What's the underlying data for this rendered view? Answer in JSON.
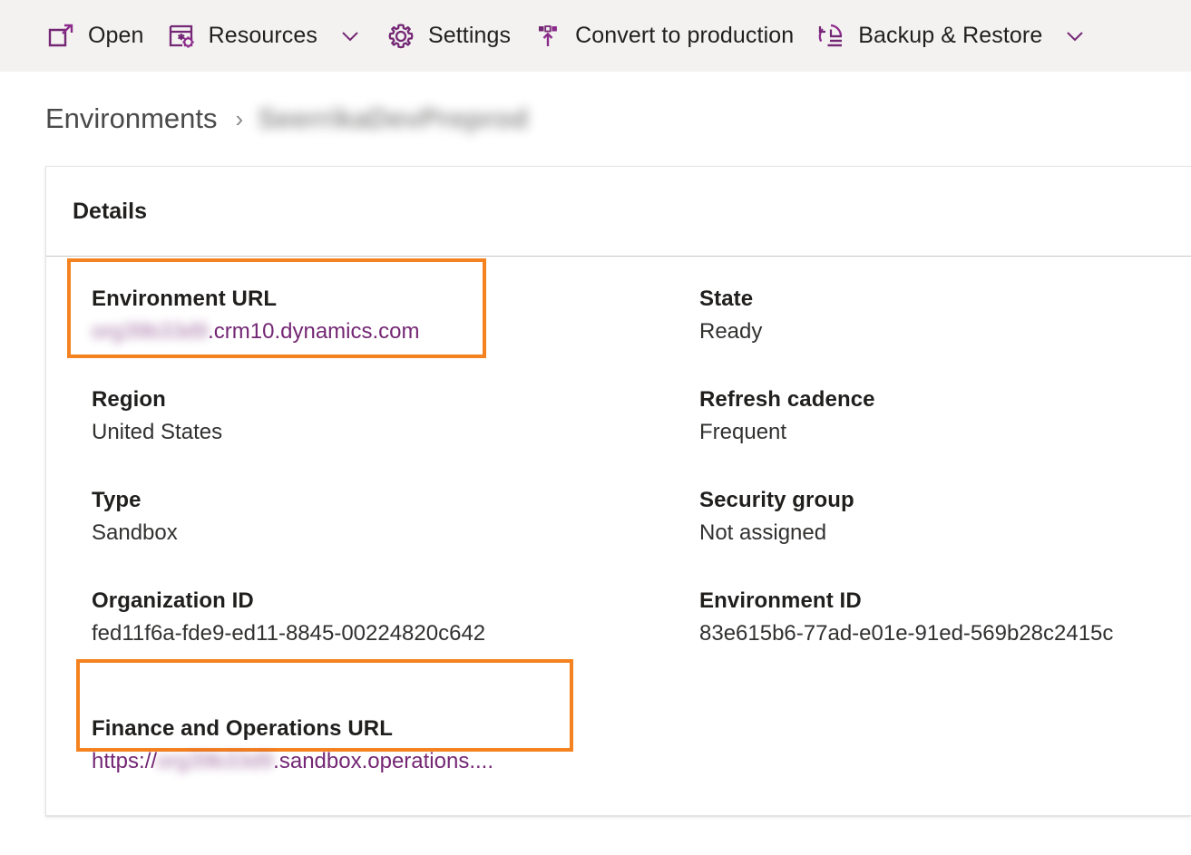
{
  "commandbar": {
    "items": [
      {
        "label": "Open",
        "icon": "open-in-new-icon",
        "has_chevron": false
      },
      {
        "label": "Resources",
        "icon": "resources-icon",
        "has_chevron": true
      },
      {
        "label": "Settings",
        "icon": "gear-icon",
        "has_chevron": false
      },
      {
        "label": "Convert to production",
        "icon": "convert-production-icon",
        "has_chevron": false
      },
      {
        "label": "Backup & Restore",
        "icon": "backup-restore-icon",
        "has_chevron": true
      }
    ]
  },
  "breadcrumb": {
    "root": "Environments",
    "separator": "›",
    "current": "SeerrikaDevPreprod"
  },
  "card": {
    "header_title": "Details",
    "fields": {
      "environment_url": {
        "label": "Environment URL",
        "redacted": "org39b33d9",
        "value_suffix": ".crm10.dynamics.com",
        "is_link": true,
        "highlighted": true
      },
      "state": {
        "label": "State",
        "value": "Ready"
      },
      "region": {
        "label": "Region",
        "value": "United States"
      },
      "refresh_cadence": {
        "label": "Refresh cadence",
        "value": "Frequent"
      },
      "type": {
        "label": "Type",
        "value": "Sandbox"
      },
      "security_group": {
        "label": "Security group",
        "value": "Not assigned"
      },
      "organization_id": {
        "label": "Organization ID",
        "value": "fed11f6a-fde9-ed11-8845-00224820c642"
      },
      "environment_id": {
        "label": "Environment ID",
        "value": "83e615b6-77ad-e01e-91ed-569b28c2415c"
      },
      "fno_url": {
        "label": "Finance and Operations URL",
        "value_prefix": "https://",
        "redacted": "org39b33d9",
        "value_suffix": ".sandbox.operations....",
        "is_link": true,
        "highlighted": true
      }
    }
  },
  "colors": {
    "accent_purple": "#742774",
    "highlight_orange": "#f58220",
    "commandbar_bg": "#f3f2f1",
    "text_primary": "#201f1e",
    "divider": "#c8c6c4"
  }
}
